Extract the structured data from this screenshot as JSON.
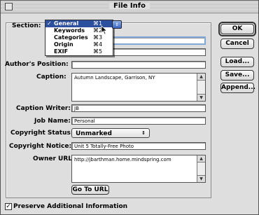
{
  "window": {
    "title": "File Info"
  },
  "section": {
    "label": "Section:",
    "menu": [
      {
        "label": "General",
        "shortcut": "⌘1",
        "check": "✓"
      },
      {
        "label": "Keywords",
        "shortcut": "⌘2"
      },
      {
        "label": "Categories",
        "shortcut": "⌘3"
      },
      {
        "label": "Origin",
        "shortcut": "⌘4"
      },
      {
        "label": "EXIF",
        "shortcut": "⌘5"
      }
    ]
  },
  "form": {
    "authors_position": {
      "label": "Author's Position:",
      "value": ""
    },
    "caption": {
      "label": "Caption:",
      "value": "Autumn Landscape, Garrison, NY"
    },
    "caption_writer": {
      "label": "Caption Writer:",
      "value": "JB"
    },
    "job_name": {
      "label": "Job Name:",
      "value": "Personal"
    },
    "copyright_status": {
      "label": "Copyright Status:",
      "value": "Unmarked"
    },
    "copyright_notice": {
      "label": "Copyright Notice:",
      "value": "Unit 5 Totally-Free Photo"
    },
    "owner_url": {
      "label": "Owner URL:",
      "value": "http://jbarthman.home.mindspring.com"
    }
  },
  "buttons": {
    "ok": "OK",
    "cancel": "Cancel",
    "load": "Load...",
    "save": "Save...",
    "append": "Append...",
    "go_to_url": "Go To URL"
  },
  "preserve": {
    "label": "Preserve Additional Information",
    "checked": true,
    "mark": "✓"
  },
  "icons": {
    "dropdown": "⇕",
    "scroll_up": "▲",
    "scroll_down": "▼"
  }
}
